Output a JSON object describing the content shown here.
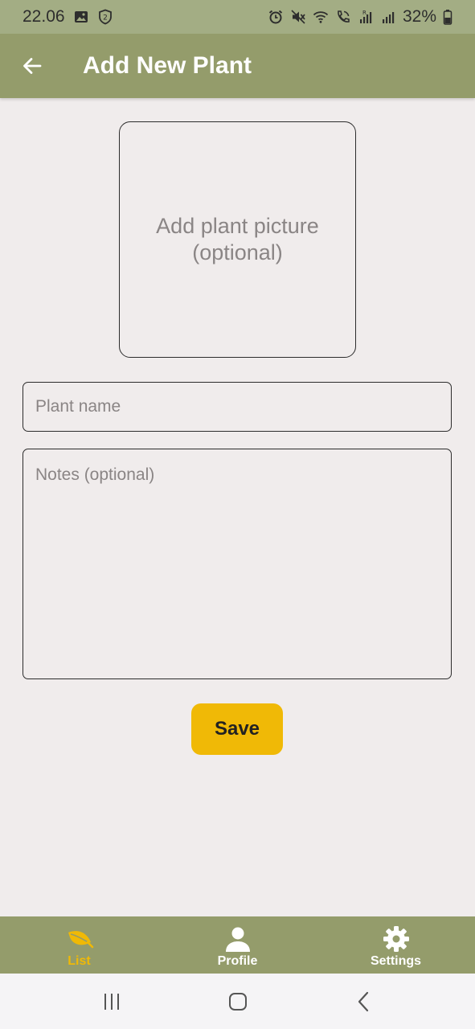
{
  "status_bar": {
    "time": "22.06",
    "battery": "32%",
    "left_icons": [
      "image-icon",
      "shield-2-icon"
    ],
    "right_icons": [
      "alarm-icon",
      "mute-icon",
      "wifi-icon",
      "wifi-call-icon",
      "signal-r-icon",
      "signal-icon",
      "battery-icon"
    ]
  },
  "app_bar": {
    "title": "Add New Plant",
    "back_icon": "arrow-left-icon"
  },
  "form": {
    "picture_placeholder": "Add plant picture\n(optional)",
    "name_placeholder": "Plant name",
    "name_value": "",
    "notes_placeholder": "Notes (optional)",
    "notes_value": "",
    "save_label": "Save"
  },
  "bottom_nav": {
    "items": [
      {
        "label": "List",
        "icon": "leaf-icon",
        "active": true
      },
      {
        "label": "Profile",
        "icon": "person-icon",
        "active": false
      },
      {
        "label": "Settings",
        "icon": "gear-icon",
        "active": false
      }
    ]
  },
  "colors": {
    "status_bar": "#a3ad84",
    "app_bar": "#949c6b",
    "background": "#f0ecec",
    "accent": "#f0b906",
    "placeholder": "#8a8585"
  }
}
